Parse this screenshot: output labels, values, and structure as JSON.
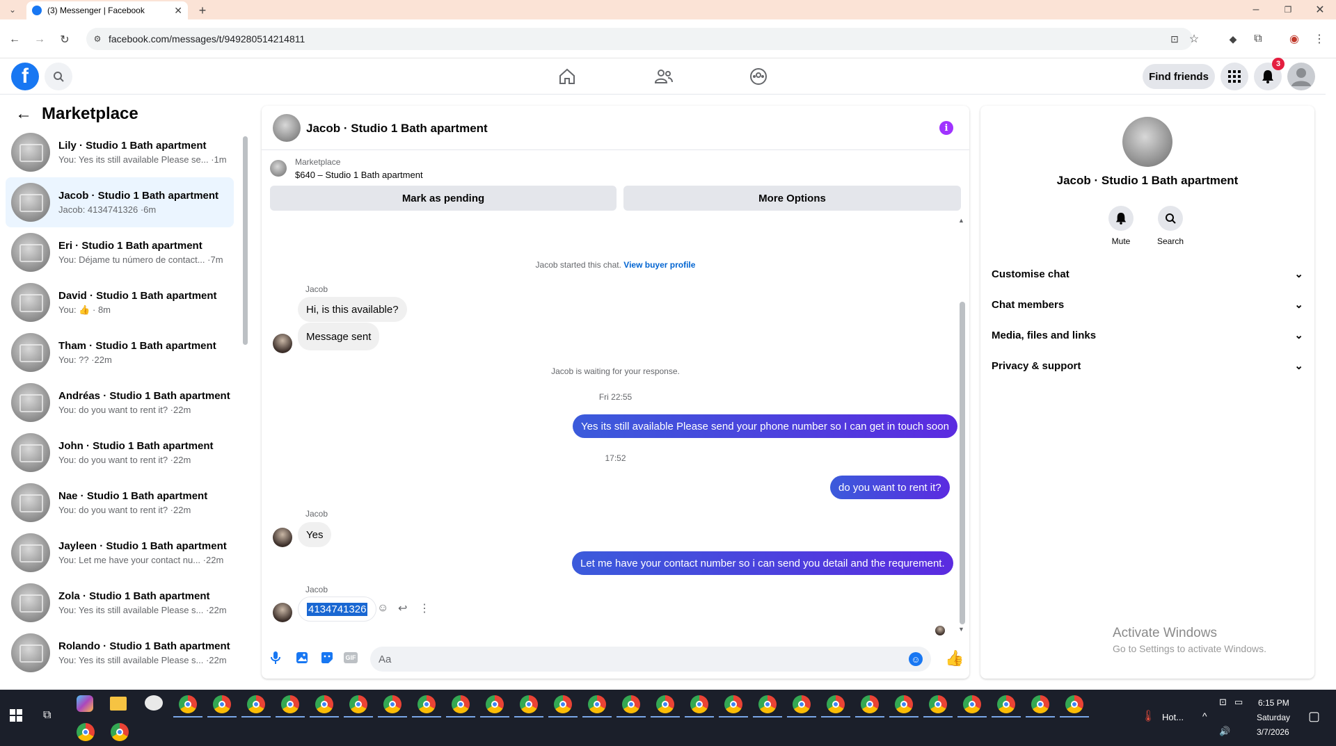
{
  "browser": {
    "tab_title": "(3) Messenger | Facebook",
    "url": "facebook.com/messages/t/949280514214811"
  },
  "header": {
    "find_friends": "Find friends",
    "notification_count": "3"
  },
  "sidebar": {
    "title": "Marketplace",
    "conversations": [
      {
        "name": "Lily · Studio 1 Bath apartment",
        "snippet": "You: Yes its still available Please se... ·1m"
      },
      {
        "name": "Jacob · Studio 1 Bath apartment",
        "snippet": "Jacob: 4134741326 ·6m"
      },
      {
        "name": "Eri · Studio 1 Bath apartment",
        "snippet": "You: Déjame tu número de contact... ·7m"
      },
      {
        "name": "David · Studio 1 Bath apartment",
        "snippet_prefix": "You:",
        "snippet_suffix": "· 8m"
      },
      {
        "name": "Tham · Studio 1 Bath apartment",
        "snippet": "You: ?? ·22m"
      },
      {
        "name": "Andréas · Studio 1 Bath apartment",
        "snippet": "You: do you want to rent it? ·22m"
      },
      {
        "name": "John · Studio 1 Bath apartment",
        "snippet": "You: do you want to rent it? ·22m"
      },
      {
        "name": "Nae · Studio 1 Bath apartment",
        "snippet": "You: do you want to rent it? ·22m"
      },
      {
        "name": "Jayleen · Studio 1 Bath apartment",
        "snippet": "You: Let me have your contact nu... ·22m"
      },
      {
        "name": "Zola · Studio 1 Bath apartment",
        "snippet": "You: Yes its still available Please s... ·22m"
      },
      {
        "name": "Rolando · Studio 1 Bath apartment",
        "snippet": "You: Yes its still available Please s... ·22m"
      }
    ]
  },
  "chat": {
    "title": "Jacob · Studio 1 Bath apartment",
    "listing_source": "Marketplace",
    "listing": "$640 – Studio 1 Bath apartment",
    "mark_pending": "Mark as pending",
    "more_options": "More Options",
    "started_text": "Jacob started this chat.",
    "view_profile": "View buyer profile",
    "sender_name": "Jacob",
    "msg1": "Hi, is this available?",
    "msg2": "Message sent",
    "waiting": "Jacob is waiting for your response.",
    "time1": "Fri 22:55",
    "out1": "Yes its still available Please send your phone number so I can get in touch soon",
    "time2": "17:52",
    "out2": "do you want to rent it?",
    "msg3": "Yes",
    "out3": "Let me have your contact number so i can send you detail and the requrement.",
    "msg4": "4134741326",
    "input_placeholder": "Aa"
  },
  "details": {
    "title": "Jacob · Studio 1 Bath apartment",
    "mute": "Mute",
    "search": "Search",
    "sections": [
      "Customise chat",
      "Chat members",
      "Media, files and links",
      "Privacy & support"
    ]
  },
  "watermark": {
    "line1": "Activate Windows",
    "line2": "Go to Settings to activate Windows."
  },
  "taskbar": {
    "weather": "Hot...",
    "time": "6:15 PM",
    "day": "Saturday",
    "date": "3/7/2026"
  },
  "colors": {
    "fb_blue": "#1877f2",
    "outgoing_bubble": "#4f3ff0",
    "info_icon": "#a033ff"
  }
}
